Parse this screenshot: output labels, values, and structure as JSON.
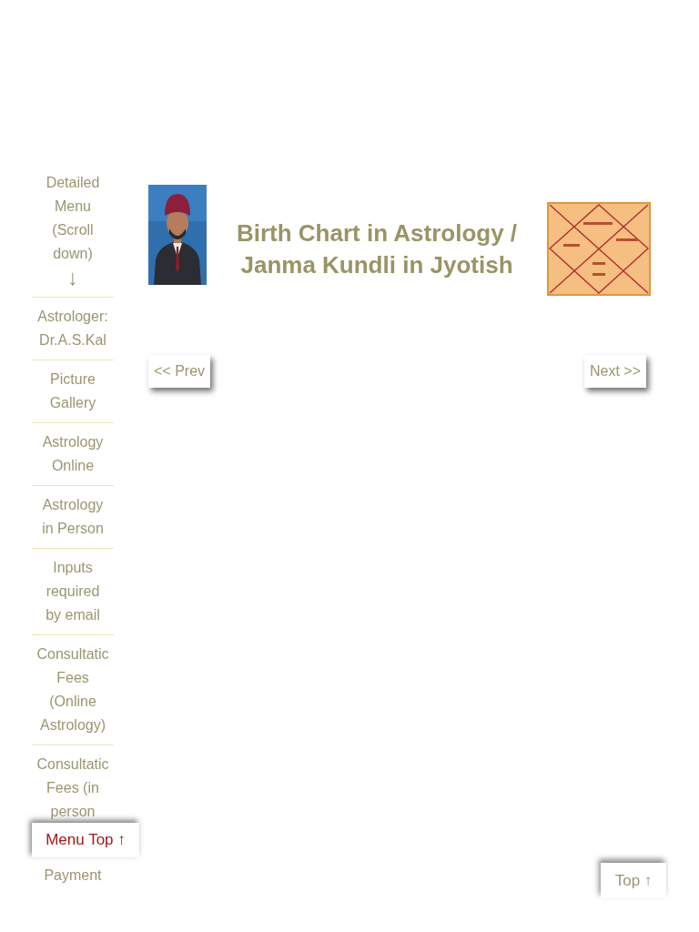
{
  "sidebar": {
    "items": [
      {
        "lines": [
          "Detailed",
          "Menu",
          "(Scroll",
          "down)"
        ],
        "arrow": "↓"
      },
      {
        "lines": [
          "Astrologer:",
          "Dr.A.S.Kal"
        ]
      },
      {
        "lines": [
          "Picture",
          "Gallery"
        ]
      },
      {
        "lines": [
          "Astrology",
          "Online"
        ]
      },
      {
        "lines": [
          "Astrology",
          "in Person"
        ]
      },
      {
        "lines": [
          "Inputs",
          "required",
          "by email"
        ]
      },
      {
        "lines": [
          "Consultatic",
          "Fees",
          "(Online",
          "Astrology)"
        ]
      },
      {
        "lines": [
          "Consultatic",
          "Fees (in",
          "person"
        ]
      },
      {
        "lines": [
          "Payment"
        ]
      }
    ],
    "menu_top": {
      "label": "Menu Top",
      "arrow": "↑"
    }
  },
  "header": {
    "photo": {
      "kind": "picture"
    },
    "title_lines": [
      "Birth Chart in Astrology /",
      "Janma Kundli in Jyotish"
    ],
    "chart_image": {
      "kind": "picture"
    }
  },
  "nav": {
    "prev": "<< Prev",
    "next": "Next >>"
  },
  "top_button": {
    "label": "Top",
    "arrow": "↑"
  }
}
